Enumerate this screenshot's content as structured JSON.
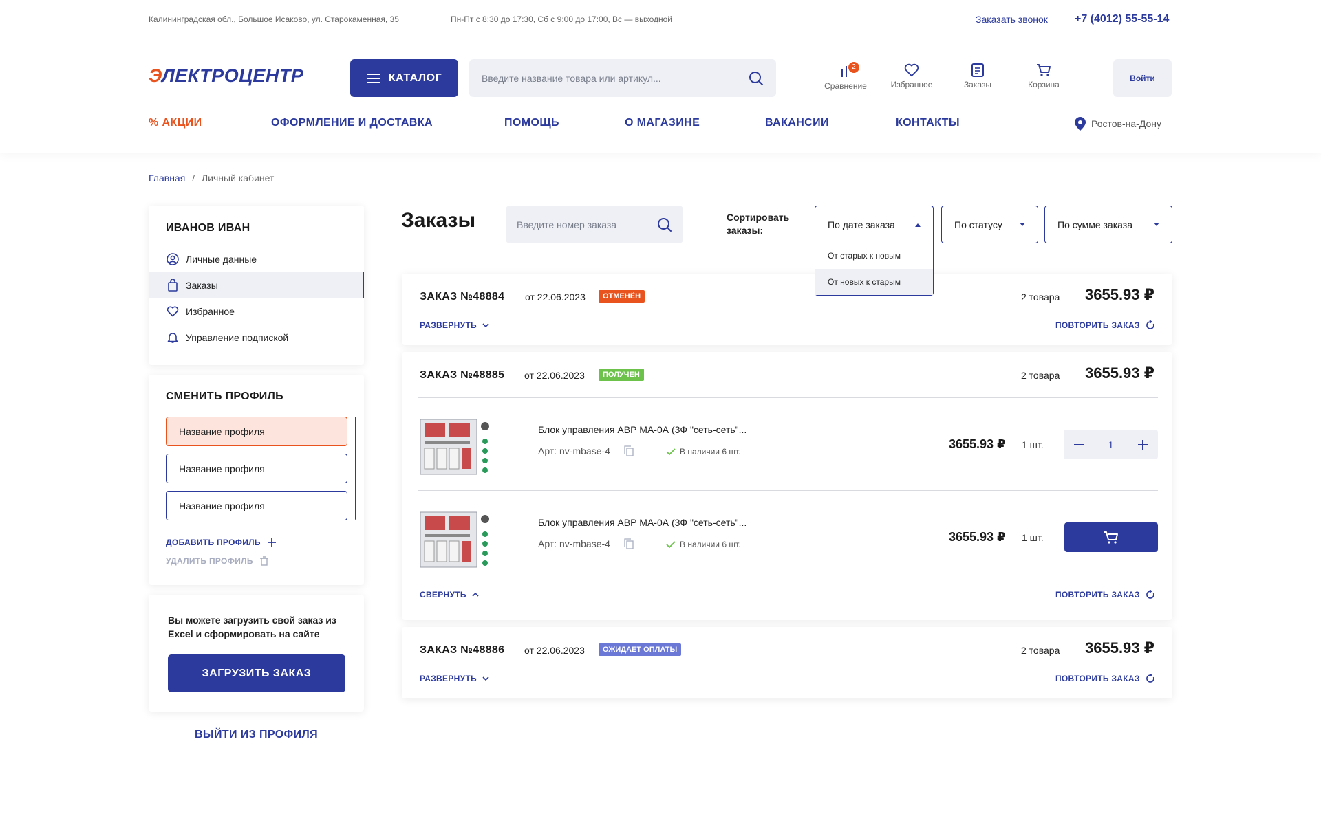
{
  "topbar": {
    "address": "Калининградская обл., Большое Исаково, ул. Старокаменная, 35",
    "hours": "Пн-Пт с 8:30 до 17:30,  Сб с 9:00 до 17:00, Вс — выходной",
    "callback": "Заказать звонок",
    "phone": "+7 (4012) 55-55-14"
  },
  "header": {
    "logo_first": "Э",
    "logo_rest": "ЛЕКТРОЦЕНТР",
    "catalog_label": "КАТАЛОГ",
    "search_placeholder": "Введите название товара или артикул...",
    "icons": [
      {
        "label": "Сравнение",
        "icon": "compare-icon",
        "badge": "2"
      },
      {
        "label": "Избранное",
        "icon": "heart-icon"
      },
      {
        "label": "Заказы",
        "icon": "orders-icon"
      },
      {
        "label": "Корзина",
        "icon": "cart-icon"
      }
    ],
    "login_label": "Войти"
  },
  "nav": {
    "items": [
      "% АКЦИИ",
      "ОФОРМЛЕНИЕ И ДОСТАВКА",
      "ПОМОЩЬ",
      "О МАГАЗИНЕ",
      "ВАКАНСИИ",
      "КОНТАКТЫ"
    ],
    "city": "Ростов-на-Дону"
  },
  "breadcrumbs": {
    "home": "Главная",
    "separator": "/",
    "current": "Личный кабинет"
  },
  "sidebar": {
    "user_name": "ИВАНОВ ИВАН",
    "menu": [
      {
        "label": "Личные данные",
        "icon": "user-icon"
      },
      {
        "label": "Заказы",
        "icon": "bag-icon",
        "active": true
      },
      {
        "label": "Избранное",
        "icon": "heart-icon"
      },
      {
        "label": "Управление подпиской",
        "icon": "bell-icon"
      }
    ],
    "profile_title": "СМЕНИТЬ ПРОФИЛЬ",
    "profiles": [
      "Название профиля",
      "Название профиля",
      "Название профиля"
    ],
    "add_profile": "ДОБАВИТЬ ПРОФИЛЬ",
    "delete_profile": "УДАЛИТЬ ПРОФИЛЬ",
    "upload_text": "Вы можете загрузить свой заказ из Excel и сформировать на сайте",
    "upload_button": "ЗАГРУЗИТЬ ЗАКАЗ",
    "logout": "ВЫЙТИ ИЗ ПРОФИЛЯ"
  },
  "content": {
    "title": "Заказы",
    "order_search_placeholder": "Введите номер заказа",
    "sort_label": "Сортировать заказы:",
    "sort_date": "По дате заказа",
    "sort_status": "По статусу",
    "sort_sum": "По сумме заказа",
    "sort_options": [
      "От старых к новым",
      "От новых к старым"
    ],
    "expand": "РАЗВЕРНУТЬ",
    "collapse": "СВЕРНУТЬ",
    "repeat": "ПОВТОРИТЬ ЗАКАЗ",
    "orders": [
      {
        "number": "ЗАКАЗ №48884",
        "date": "от 22.06.2023",
        "status": "ОТМЕНЁН",
        "status_color": "#e8531e",
        "count": "2 товара",
        "sum": "3655.93 ₽"
      },
      {
        "number": "ЗАКАЗ №48885",
        "date": "от 22.06.2023",
        "status": "ПОЛУЧЕН",
        "status_color": "#6cc24a",
        "count": "2 товара",
        "sum": "3655.93 ₽"
      },
      {
        "number": "ЗАКАЗ №48886",
        "date": "от 22.06.2023",
        "status": "ОЖИДАЕТ ОПЛАТЫ",
        "status_color": "#6b78d6",
        "count": "2 товара",
        "sum": "3655.93 ₽"
      }
    ],
    "products": [
      {
        "name": "Блок управления АВР МА-0А (3Ф \"сеть-сеть\"...",
        "art": "Арт: nv-mbase-4_",
        "stock": "В наличии 6 шт.",
        "price": "3655.93 ₽",
        "qty": "1 шт.",
        "stepper_value": "1"
      },
      {
        "name": "Блок управления АВР МА-0А (3Ф \"сеть-сеть\"...",
        "art": "Арт: nv-mbase-4_",
        "stock": "В наличии 6 шт.",
        "price": "3655.93 ₽",
        "qty": "1 шт."
      }
    ]
  },
  "colors": {
    "brand_blue": "#2b3a9c",
    "brand_orange": "#e8531e",
    "light_bg": "#eef0f5"
  }
}
